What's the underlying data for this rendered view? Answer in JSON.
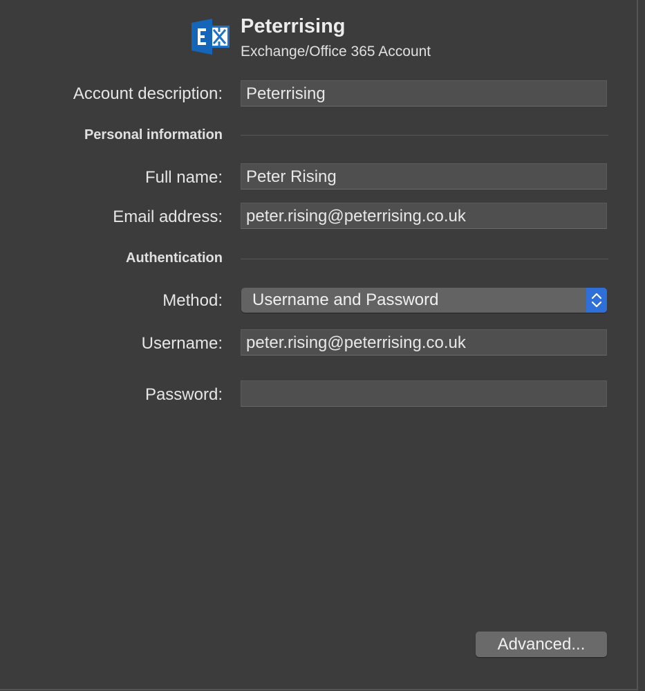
{
  "header": {
    "account_name": "Peterrising",
    "account_type": "Exchange/Office 365 Account",
    "icon": "exchange-icon",
    "icon_color": "#1e73c8"
  },
  "account_description": {
    "label": "Account description:",
    "value": "Peterrising"
  },
  "personal_information": {
    "heading": "Personal information",
    "full_name": {
      "label": "Full name:",
      "value": "Peter Rising"
    },
    "email": {
      "label": "Email address:",
      "value": "peter.rising@peterrising.co.uk"
    }
  },
  "authentication": {
    "heading": "Authentication",
    "method": {
      "label": "Method:",
      "value": "Username and Password",
      "icon": "chevron-up-down-icon",
      "accent_color": "#2f6fd8"
    },
    "username": {
      "label": "Username:",
      "value": "peter.rising@peterrising.co.uk"
    },
    "password": {
      "label": "Password:",
      "value": ""
    }
  },
  "buttons": {
    "advanced": "Advanced..."
  }
}
